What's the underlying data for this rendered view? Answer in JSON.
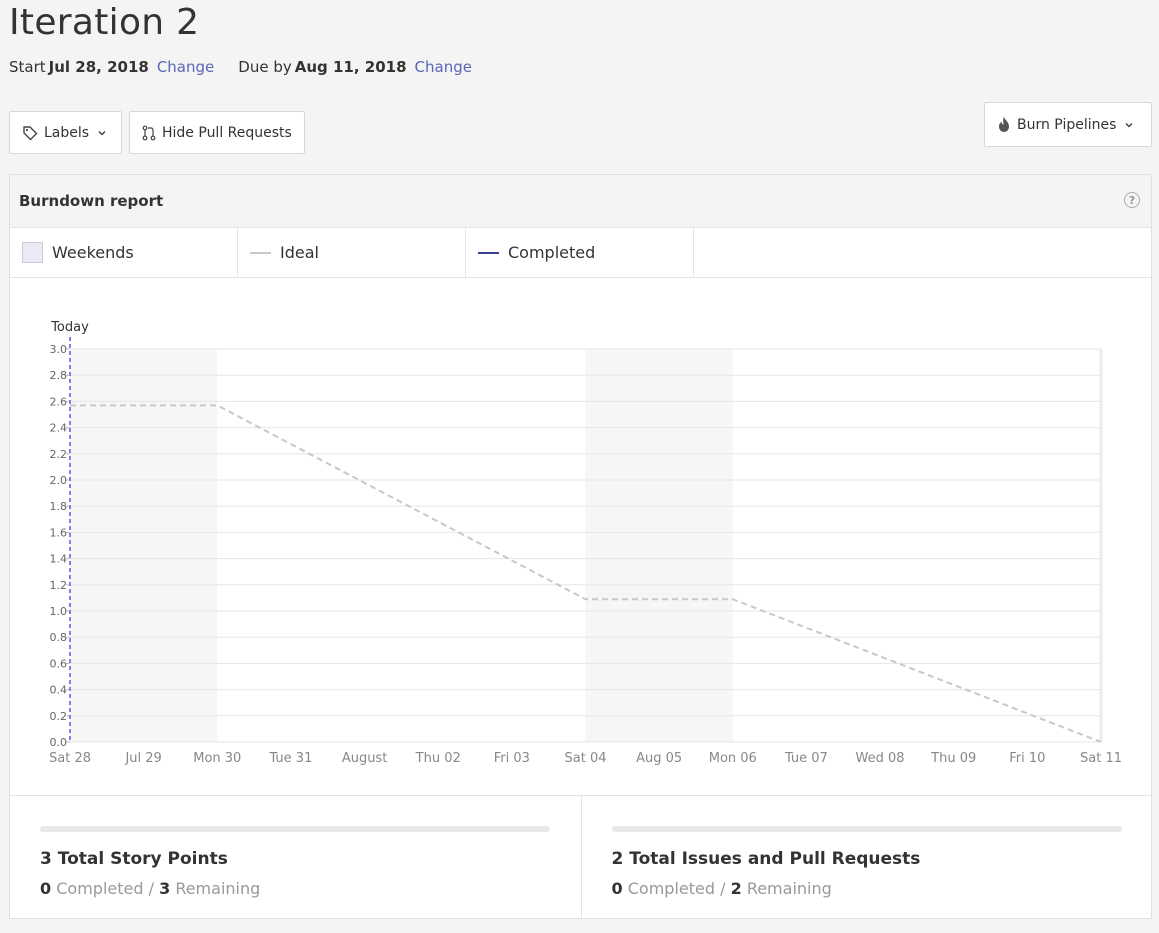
{
  "header": {
    "title": "Iteration 2",
    "start_prefix": "Start",
    "start_date": "Jul 28, 2018",
    "start_change": "Change",
    "due_prefix": "Due by",
    "due_date": "Aug 11, 2018",
    "due_change": "Change"
  },
  "toolbar": {
    "labels_button": "Labels",
    "hide_pr_button": "Hide Pull Requests",
    "burn_button": "Burn Pipelines"
  },
  "report": {
    "title": "Burndown report",
    "help": "?",
    "legend": [
      {
        "label": "Weekends",
        "color": "#ebebf5"
      },
      {
        "label": "Ideal",
        "color": "#c8c8c8"
      },
      {
        "label": "Completed",
        "color": "#3b3f8f"
      }
    ]
  },
  "chart_data": {
    "type": "line",
    "today_label": "Today",
    "x_tick_labels": [
      "Sat 28",
      "Jul 29",
      "Mon 30",
      "Tue 31",
      "August",
      "Thu 02",
      "Fri 03",
      "Sat 04",
      "Aug 05",
      "Mon 06",
      "Tue 07",
      "Wed 08",
      "Thu 09",
      "Fri 10",
      "Sat 11"
    ],
    "y_ticks": [
      "0.0",
      "0.2",
      "0.4",
      "0.6",
      "0.8",
      "1.0",
      "1.2",
      "1.4",
      "1.6",
      "1.8",
      "2.0",
      "2.2",
      "2.4",
      "2.6",
      "2.8",
      "3.0"
    ],
    "ylim": [
      0,
      3.0
    ],
    "weekend_ranges": [
      [
        0,
        2
      ],
      [
        7,
        9
      ]
    ],
    "series": [
      {
        "name": "Ideal",
        "style": "dashed",
        "color": "#c8c8c8",
        "x": [
          0,
          2,
          7,
          9,
          14
        ],
        "values": [
          2.57,
          2.57,
          1.09,
          1.09,
          0.0
        ]
      }
    ],
    "today_index": 0,
    "today_color": "#8a7fe0",
    "grid": true
  },
  "stats": [
    {
      "heading": "3 Total Story Points",
      "completed_value": "0",
      "completed_label": "Completed /",
      "remaining_value": "3",
      "remaining_label": "Remaining",
      "progress": 0
    },
    {
      "heading": "2 Total Issues and Pull Requests",
      "completed_value": "0",
      "completed_label": "Completed /",
      "remaining_value": "2",
      "remaining_label": "Remaining",
      "progress": 0
    }
  ]
}
